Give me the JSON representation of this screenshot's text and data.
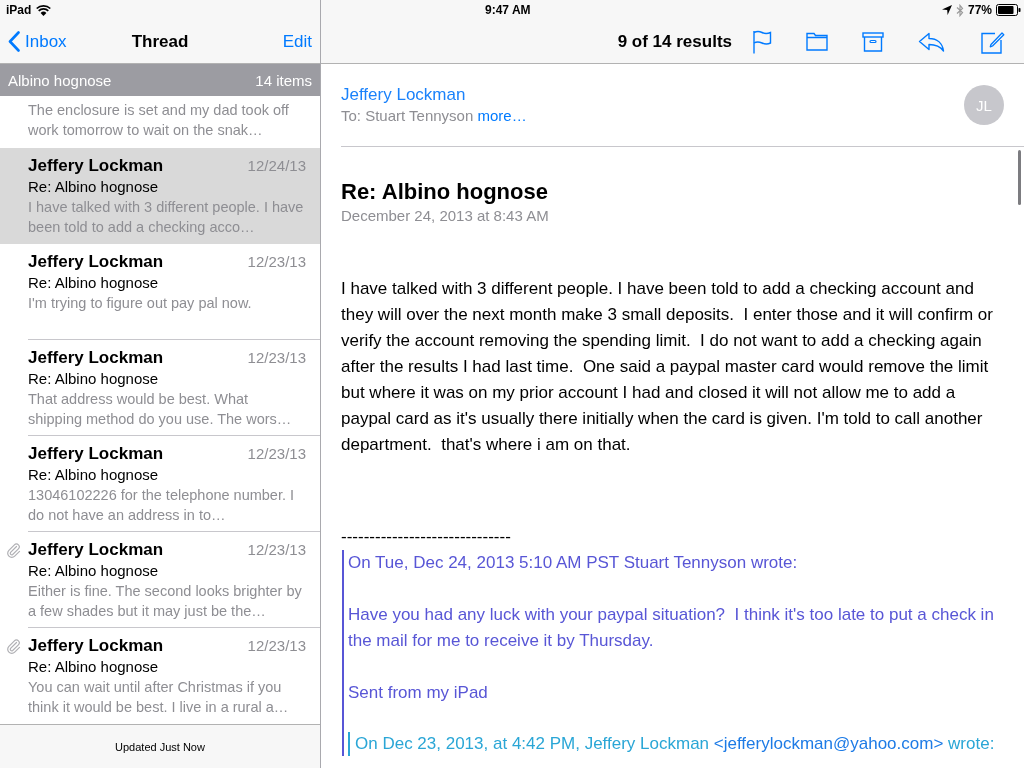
{
  "status_bar": {
    "device": "iPad",
    "time": "9:47 AM",
    "battery": "77%"
  },
  "mailbox_nav": {
    "back": "Inbox",
    "title": "Thread",
    "action": "Edit"
  },
  "thread_header": {
    "title": "Albino hognose",
    "count": "14 items"
  },
  "messages": [
    {
      "preview": "The enclosure is set and my dad took off work tomorrow to wait on the snak…",
      "selected": false,
      "attachment": false
    },
    {
      "sender": "Jeffery Lockman",
      "date": "12/24/13",
      "subject": "Re: Albino hognose",
      "preview": "I have talked with 3 different people. I have been told to add a checking acco…",
      "selected": true,
      "attachment": false
    },
    {
      "sender": "Jeffery Lockman",
      "date": "12/23/13",
      "subject": "Re: Albino hognose",
      "preview": "I'm trying to figure out pay pal now.",
      "selected": false,
      "attachment": false
    },
    {
      "sender": "Jeffery Lockman",
      "date": "12/23/13",
      "subject": "Re: Albino hognose",
      "preview": "That address would be best. What shipping method do you use. The wors…",
      "selected": false,
      "attachment": false
    },
    {
      "sender": "Jeffery Lockman",
      "date": "12/23/13",
      "subject": "Re: Albino hognose",
      "preview": "13046102226 for the telephone number. I do not have an address in to…",
      "selected": false,
      "attachment": false
    },
    {
      "sender": "Jeffery Lockman",
      "date": "12/23/13",
      "subject": "Re: Albino hognose",
      "preview": "Either is fine. The second looks brighter by a few shades but it may just be the…",
      "selected": false,
      "attachment": true
    },
    {
      "sender": "Jeffery Lockman",
      "date": "12/23/13",
      "subject": "Re: Albino hognose",
      "preview": "You can wait until after Christmas if you think it would be best. I live in a rural a…",
      "selected": false,
      "attachment": true
    }
  ],
  "footer": {
    "status": "Updated Just Now"
  },
  "toolbar": {
    "result_count": "9 of 14 results"
  },
  "message": {
    "sender": "Jeffery Lockman",
    "to": "To: Stuart Tennyson",
    "more": "more…",
    "avatar": "JL",
    "subject": "Re: Albino hognose",
    "date": "December 24, 2013 at 8:43 AM",
    "body": "I have talked with 3 different people. I have been told to add a checking account and they will over the next month make 3 small deposits.  I enter those and it will confirm or verify the account removing the spending limit.  I do not want to add a checking again after the results I had last time.  One said a paypal master card would remove the limit but where it was on my prior account I had and closed it will not allow me to add a paypal card as it's usually there initially when the card is given. I'm told to call another department.  that's where i am on that.",
    "separator": "------------------------------",
    "quote": {
      "paragraphs": [
        "On Tue, Dec 24, 2013 5:10 AM PST Stuart Tennyson wrote:",
        "Have you had any luck with your paypal situation?  I think it's too late to put a check in the mail for me to receive it by Thursday.",
        "Sent from my iPad"
      ],
      "nested": {
        "before": "On Dec 23, 2013, at 4:42 PM, Jeffery Lockman ",
        "email": "<jefferylockman@yahoo.com>",
        "after": " wrote:"
      }
    }
  }
}
